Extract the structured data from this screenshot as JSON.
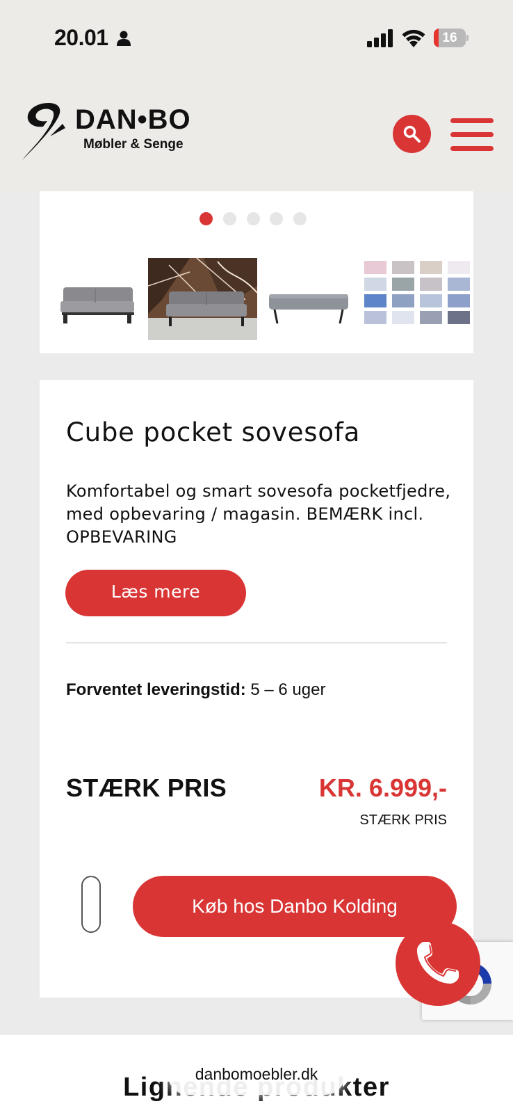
{
  "status_bar": {
    "time": "20.01",
    "battery_level": "16",
    "battery_fraction": 0.16,
    "icons": [
      "person-icon",
      "signal-icon",
      "wifi-icon",
      "battery-icon"
    ]
  },
  "header": {
    "logo_text": "DAN•BO",
    "logo_subtitle": "Møbler & Senge",
    "search_icon": "search-icon",
    "menu_icon": "hamburger-menu-icon"
  },
  "gallery": {
    "dots_count": 5,
    "active_dot": 0,
    "thumbnails": [
      "sofa-side-view",
      "sofa-marble-background",
      "sofa-bed-flat",
      "fabric-color-swatches"
    ]
  },
  "product": {
    "title": "Cube pocket sovesofa",
    "description": "Komfortabel og smart sovesofa pocketfjedre, med opbevaring / magasin. BEMÆRK incl. OPBEVARING",
    "read_more_label": "Læs mere",
    "delivery_label": "Forventet leveringstid:",
    "delivery_value": " 5 – 6 uger",
    "price_label": "STÆRK PRIS",
    "price_value": "KR. 6.999,-",
    "price_sublabel": "STÆRK PRIS",
    "buy_label": "Køb hos Danbo Kolding"
  },
  "floating": {
    "phone_icon": "phone-icon",
    "recaptcha_icon": "recaptcha-icon"
  },
  "related": {
    "title": "Lignende produkter"
  },
  "browser": {
    "url": "danbomoebler.dk"
  },
  "colors": {
    "brand_red": "#d93535",
    "header_bg": "#ecebe8",
    "page_bg": "#ebebeb"
  }
}
